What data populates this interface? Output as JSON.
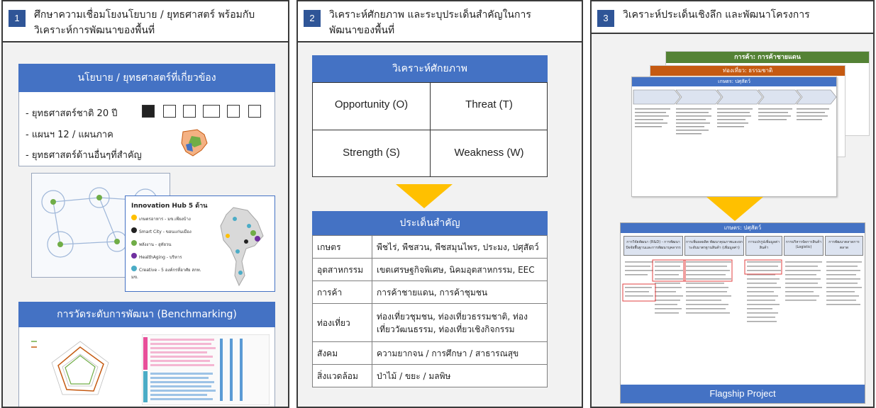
{
  "panel1": {
    "number": "1",
    "title_line1": "ศึกษาความเชื่อมโยงนโยบาย / ยุทธศาสตร์ พร้อมกับ",
    "title_line2": "วิเคราะห์การพัฒนาของพื้นที่",
    "policy_banner": "นโยบาย / ยุทธศาสตร์ที่เกี่ยวข้อง",
    "policy_items": [
      "ยุทธศาสตร์ชาติ 20 ปี",
      "แผนฯ 12 / แผนภาค",
      "ยุทธศาสตร์ด้านอื่นๆที่สำคัญ"
    ],
    "innovation_title": "Innovation Hub 5 ด้าน",
    "innovation_items": [
      "เกษตรอาหาร - มข.เพียงบ้าง",
      "Smart City - ขอนแก่นเมือง",
      "พลังงาน - อุทัยวน",
      "HealthAging - บริหาร",
      "Creative - 5 องค์กรที่อาศัย สกท. มข."
    ],
    "benchmark_banner": "การวัดระดับการพัฒนา (Benchmarking)"
  },
  "panel2": {
    "number": "2",
    "title_line1": "วิเคราะห์ศักยภาพ และระบุประเด็นสำคัญในการ",
    "title_line2": "พัฒนาของพื้นที่",
    "swot_banner": "วิเคราะห์ศักยภาพ",
    "swot": {
      "opportunity": "Opportunity (O)",
      "threat": "Threat (T)",
      "strength": "Strength (S)",
      "weakness": "Weakness  (W)"
    },
    "issues_banner": "ประเด็นสำคัญ",
    "issues": [
      {
        "sector": "เกษตร",
        "detail": "พืชไร่, พืชสวน, พืชสมุนไพร, ประมง, ปศุสัตว์"
      },
      {
        "sector": "อุตสาหกรรม",
        "detail": "เขตเศรษฐกิจพิเศษ, นิคมอุตสาหกรรม, EEC"
      },
      {
        "sector": "การค้า",
        "detail": "การค้าชายแดน, การค้าชุมชน"
      },
      {
        "sector": "ท่องเที่ยว",
        "detail": "ท่องเที่ยวชุมชน, ท่องเที่ยวธรรมชาติ, ท่องเที่ยววัฒนธรรม, ท่องเที่ยวเชิงกิจกรรม"
      },
      {
        "sector": "สังคม",
        "detail": "ความยากจน / การศึกษา / สาธารณสุข"
      },
      {
        "sector": "สิ่งแวดล้อม",
        "detail": "ป่าไม้ / ขยะ / มลพิษ"
      }
    ]
  },
  "panel3": {
    "number": "3",
    "title": "วิเคราะห์ประเด็นเชิงลึก และพัฒนาโครงการ",
    "doc_trade": "การค้า: การค้าชายแดน",
    "doc_tourism": "ท่องเที่ยว: ธรรมชาติ",
    "doc_agri": "เกษตร: ปศุสัตว์",
    "chain_steps": [
      "การวิจัยพัฒนา (R&D) - การพัฒนาปัจจัยพื้นฐานและการพัฒนาบุคลากร",
      "การเพิ่มผลผลิต พัฒนาคุณภาพและยกระดับมาตรฐานสินค้า (เพิ่มมูลค่า)",
      "การแปรรูปเพิ่มมูลค่าสินค้า",
      "การบริหารจัดการสินค้า (Logistic)",
      "การพัฒนาตลาดการตลาด"
    ],
    "flagship_label": "Flagship Project"
  },
  "colors": {
    "accent_blue": "#4472c4",
    "number_blue": "#2f5597",
    "arrow_yellow": "#ffc000",
    "trade_green": "#548235",
    "tourism_orange": "#c55a11",
    "highlight_red": "#e04040"
  }
}
